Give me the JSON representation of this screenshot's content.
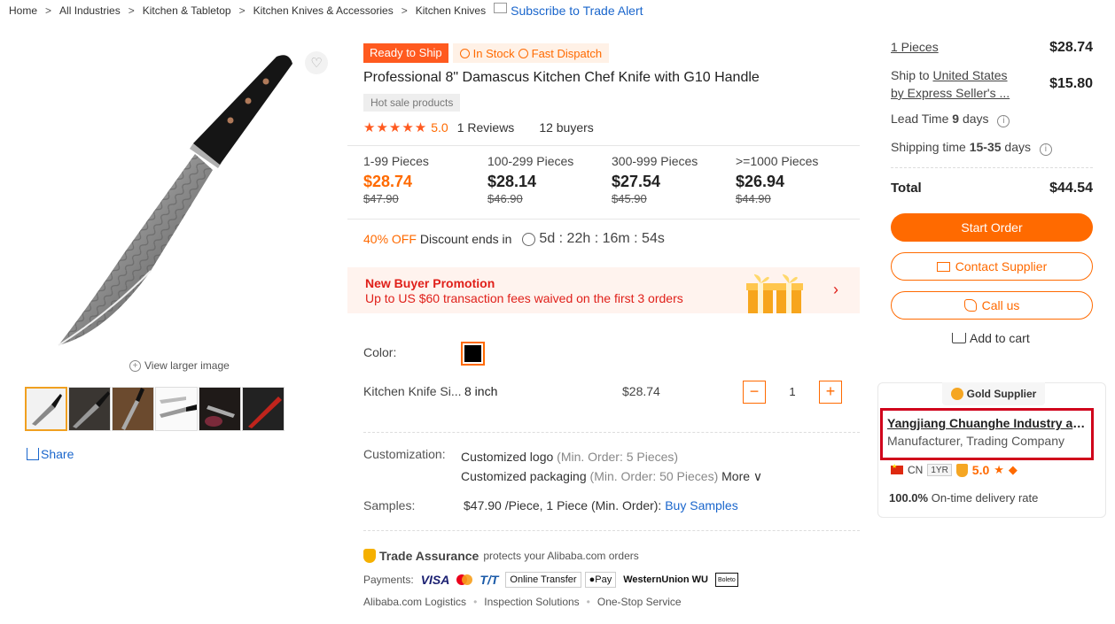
{
  "breadcrumb": {
    "items": [
      "Home",
      "All Industries",
      "Kitchen & Tabletop",
      "Kitchen Knives & Accessories",
      "Kitchen Knives"
    ],
    "separator": ">",
    "subscribe_label": "Subscribe to Trade Alert"
  },
  "gallery": {
    "view_larger": "View larger image",
    "share_label": "Share",
    "thumbnail_count": 6
  },
  "product": {
    "badge_ready": "Ready to Ship",
    "badge_stock": "In Stock",
    "badge_dispatch": "Fast Dispatch",
    "title": "Professional 8\" Damascus Kitchen Chef Knife with G10 Handle",
    "tag": "Hot sale products",
    "stars": "★★★★★",
    "rating": "5.0",
    "reviews": "1 Reviews",
    "buyers": "12 buyers"
  },
  "tiers": [
    {
      "qty": "1-99 Pieces",
      "price": "$28.74",
      "old": "$47.90"
    },
    {
      "qty": "100-299 Pieces",
      "price": "$28.14",
      "old": "$46.90"
    },
    {
      "qty": "300-999 Pieces",
      "price": "$27.54",
      "old": "$45.90"
    },
    {
      "qty": ">=1000 Pieces",
      "price": "$26.94",
      "old": "$44.90"
    }
  ],
  "discount": {
    "off": "40% OFF",
    "ends_label": "Discount ends in",
    "countdown": "5d : 22h : 16m : 54s"
  },
  "promo": {
    "title": "New Buyer Promotion",
    "subtitle": "Up to US $60 transaction fees waived on the first 3 orders",
    "arrow": "›"
  },
  "options": {
    "color_label": "Color:",
    "swatch_color": "#000000",
    "variant_name": "Kitchen Knife Si...",
    "variant_size": "8 inch",
    "variant_price": "$28.74",
    "quantity": "1",
    "minus": "−",
    "plus": "+"
  },
  "customization": {
    "label": "Customization:",
    "line1": "Customized logo",
    "line1_min": "(Min. Order: 5 Pieces)",
    "line2": "Customized packaging",
    "line2_min": "(Min. Order: 50 Pieces)",
    "more": "More ∨"
  },
  "samples": {
    "label": "Samples:",
    "value": "$47.90 /Piece, 1 Piece (Min. Order):",
    "link": "Buy Samples"
  },
  "trade_assurance": {
    "title": "Trade Assurance",
    "subtitle": "protects your Alibaba.com orders",
    "payments_label": "Payments:",
    "methods": [
      "VISA",
      "T/T",
      "Online Transfer",
      "Pay",
      "WesternUnion WU",
      "Boleto"
    ],
    "services": [
      "Alibaba.com Logistics",
      "Inspection Solutions",
      "One-Stop Service"
    ]
  },
  "summary": {
    "pieces": "1 Pieces",
    "pieces_price": "$28.74",
    "ship_to_label": "Ship to",
    "ship_country": "United States",
    "ship_method": "by Express Seller's ...",
    "ship_price": "$15.80",
    "lead_label": "Lead Time",
    "lead_days": "9",
    "lead_unit": "days",
    "shipping_label": "Shipping time",
    "shipping_days": "15-35",
    "shipping_unit": "days",
    "total_label": "Total",
    "total": "$44.54"
  },
  "actions": {
    "start_order": "Start Order",
    "contact_supplier": "Contact Supplier",
    "call_us": "Call us",
    "add_to_cart": "Add to cart"
  },
  "supplier": {
    "badge": "Gold Supplier",
    "name": "Yangjiang Chuanghe Industry and...",
    "type": "Manufacturer, Trading Company",
    "country": "CN",
    "years": "1YR",
    "score": "5.0",
    "ontime_pct": "100.0%",
    "ontime_label": "On-time delivery rate"
  },
  "colors": {
    "accent": "#ff6a00",
    "link": "#1a66cc",
    "promo_red": "#e0201a",
    "highlight": "#d0021b"
  }
}
